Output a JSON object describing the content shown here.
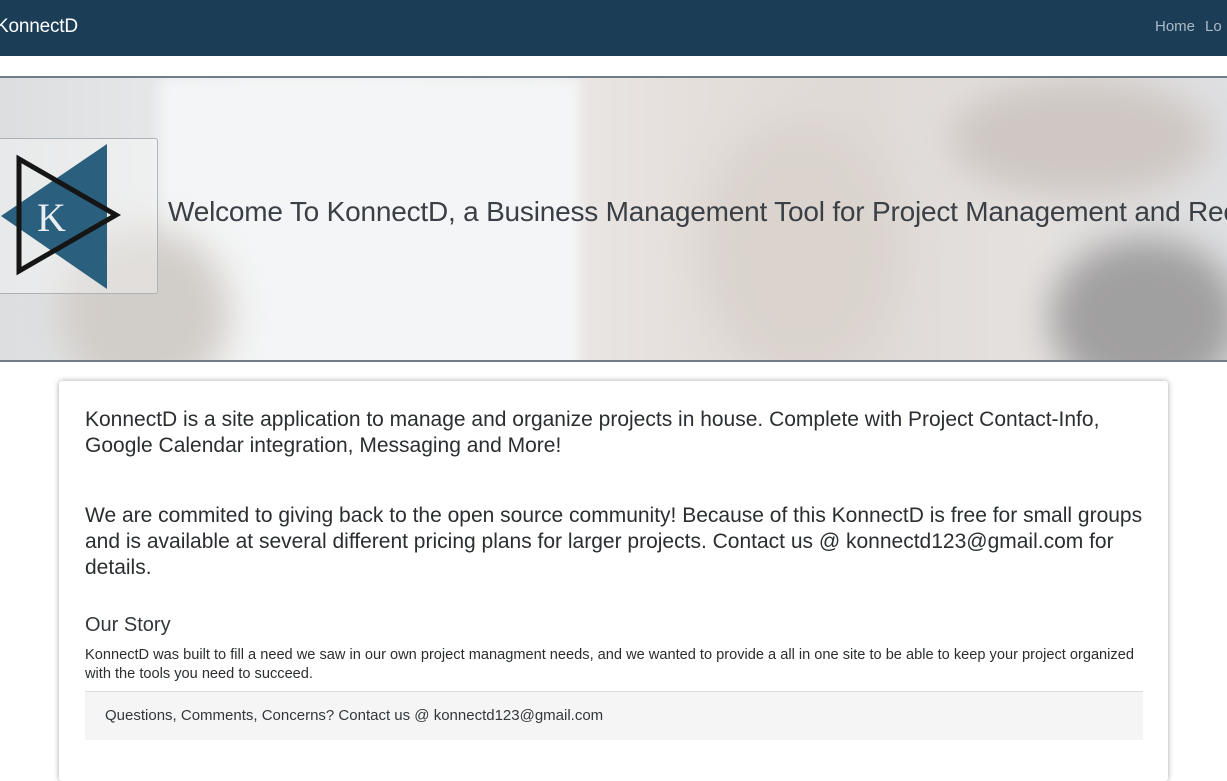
{
  "navbar": {
    "brand": "KonnectD",
    "links": [
      "Home",
      "Lo"
    ]
  },
  "hero": {
    "logo_letter": "K",
    "title": "Welcome To KonnectD, a Business Management Tool for Project Management and Reco"
  },
  "content": {
    "intro": "KonnectD is a site application to manage and organize projects in house. Complete with Project Contact-Info, Google Calendar integration, Messaging and More!",
    "community": "We are commited to giving back to the open source community! Because of this KonnectD is free for small groups and is available at several different pricing plans for larger projects. Contact us @ konnectd123@gmail.com for details.",
    "story_title": "Our Story",
    "story_text": "KonnectD was built to fill a need we saw in our own project managment needs, and we wanted to provide a all in one site to be able to keep your project organized with the tools you need to succeed.",
    "footer": "Questions, Comments, Concerns? Contact us @ konnectd123@gmail.com"
  },
  "colors": {
    "navbar": "#1b3d56",
    "logo_triangle": "#2a5f7e",
    "nav_link": "#a9bac8"
  }
}
